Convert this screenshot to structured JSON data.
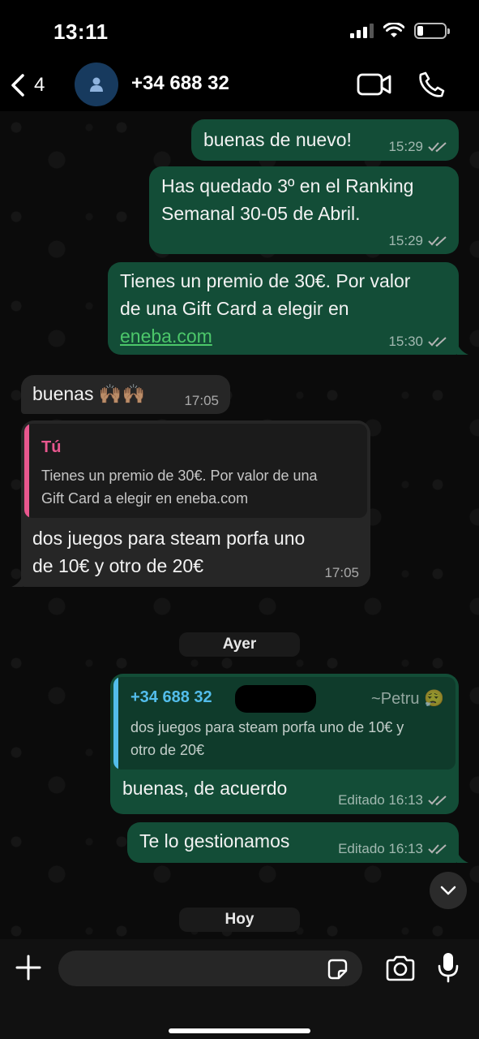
{
  "status_bar": {
    "time": "13:11",
    "battery_percent": 20
  },
  "header": {
    "back_count": "4",
    "contact": "+34 688 32",
    "icons": [
      "chevron-left-icon",
      "person-icon",
      "video-camera-icon",
      "phone-icon"
    ]
  },
  "messages": [
    {
      "lines": [
        "buenas de nuevo!"
      ],
      "time": "15:29"
    },
    {
      "lines": [
        "Has quedado 3º en el Ranking",
        "Semanal 30-05 de Abril."
      ],
      "time": "15:29"
    },
    {
      "lines": [
        "Tienes un premio de 30€. Por valor",
        "de una Gift Card a elegir en"
      ],
      "link": "eneba.com",
      "time": "15:30"
    },
    {
      "text": "buenas 🙌🏽🙌🏽",
      "time": "17:05"
    },
    {
      "quote_author": "Tú",
      "quote_lines": [
        "Tienes un premio de 30€. Por valor de una",
        "Gift Card a elegir en eneba.com"
      ],
      "lines": [
        "dos juegos para steam porfa uno",
        "de 10€ y otro de 20€"
      ],
      "time": "17:05"
    },
    {
      "quote_author": "+34 688 32",
      "quote_alias": "~Petru 😮‍💨",
      "quote_lines": [
        "dos juegos para steam porfa uno de 10€ y",
        "otro de 20€"
      ],
      "text": "buenas, de acuerdo",
      "time": "Editado 16:13"
    },
    {
      "text": "Te lo gestionamos",
      "time": "Editado 16:13"
    }
  ],
  "date_separators": [
    "Ayer",
    "Hoy"
  ],
  "composer": {
    "placeholder": ""
  },
  "colors": {
    "outgoing": "#134d37",
    "incoming": "#262626",
    "link": "#4cc76a",
    "quote_self": "#e8578e",
    "quote_other": "#53bdeb",
    "ticks": "#b3b3b3"
  }
}
